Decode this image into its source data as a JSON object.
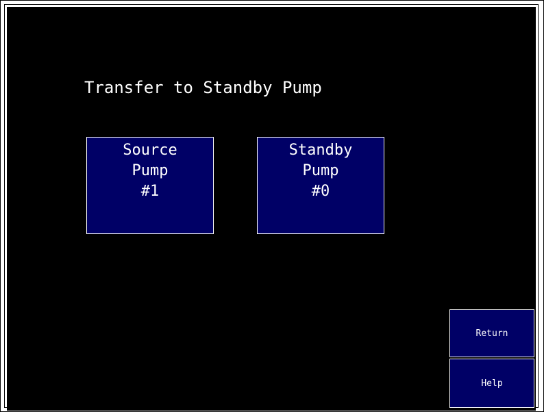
{
  "screen": {
    "title": "Transfer to Standby Pump"
  },
  "pumps": {
    "source": {
      "line1": "Source",
      "line2": "Pump",
      "line3": "#1"
    },
    "standby": {
      "line1": "Standby",
      "line2": "Pump",
      "line3": "#0"
    }
  },
  "buttons": {
    "return_label": "Return",
    "help_label": "Help"
  },
  "colors": {
    "background": "#000000",
    "button_fill": "#000066",
    "text": "#ffffff",
    "border": "#ffffff"
  }
}
